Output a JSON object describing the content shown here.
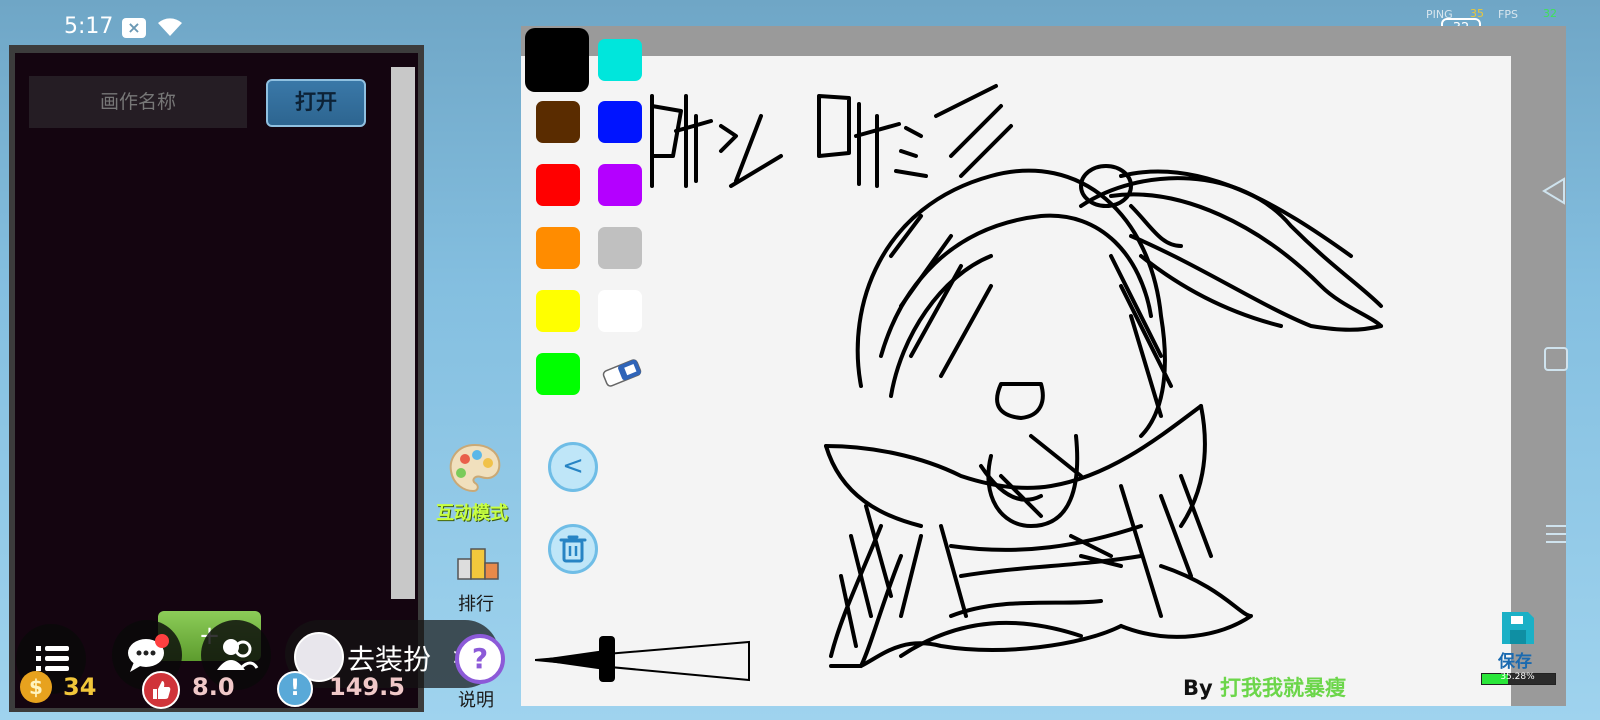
{
  "status_bar": {
    "time": "5:17",
    "notif_glyph": "×",
    "ping_label": "PING",
    "ping_value": "35",
    "fps_label": "FPS",
    "fps_value": "32",
    "badge_value": "32",
    "icons": [
      "wifi-icon",
      "notification-icon"
    ]
  },
  "left_panel": {
    "name_placeholder": "画作名称",
    "open_label": "打开",
    "add_label": "+"
  },
  "bottom_bar": {
    "dress_label": "去装扮",
    "dress_arrow": ">",
    "coin_glyph": "$",
    "coins": "34",
    "likes": "8.0",
    "warn_glyph": "!",
    "warn_value": "149.5",
    "icons": [
      "menu-icon",
      "chat-icon",
      "friends-icon",
      "coin-icon",
      "thumbs-up-icon",
      "warning-icon"
    ]
  },
  "mid_column": {
    "mode_label": "互动模式",
    "rank_label": "排行",
    "help_glyph": "?",
    "help_label": "说明"
  },
  "tools": {
    "colors": [
      "#000000",
      "#00e6dc",
      "#5a2c00",
      "#0014ff",
      "#ff0000",
      "#b400ff",
      "#ff8c00",
      "#c0c0c0",
      "#ffff00",
      "#ffffff",
      "#00ff00"
    ],
    "undo_glyph": "<",
    "icons": [
      "eraser-icon",
      "undo-icon",
      "trash-icon",
      "brush-size-slider"
    ]
  },
  "canvas": {
    "author_prefix": "By ",
    "author_name": "打我我就暴瘦"
  },
  "save": {
    "label": "保存",
    "progress_label": "35.28%",
    "progress_value": 35.28
  },
  "colors": {
    "accent_green": "#6cd64a",
    "mode_label": "#c8ff40",
    "coin": "#f2c63a"
  }
}
